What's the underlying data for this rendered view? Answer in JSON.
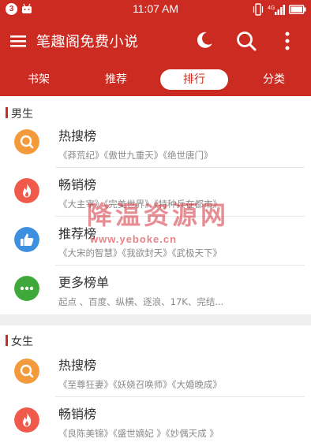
{
  "status_bar": {
    "time": "11:07 AM",
    "notification_badge": "3",
    "signal_label": "4G"
  },
  "app_bar": {
    "title": "笔趣阁免费小说",
    "icons": [
      "menu-icon",
      "moon-icon",
      "search-icon",
      "more-vert-icon"
    ]
  },
  "tabs": [
    {
      "label": "书架",
      "active": false
    },
    {
      "label": "推荐",
      "active": false
    },
    {
      "label": "排行",
      "active": true
    },
    {
      "label": "分类",
      "active": false
    }
  ],
  "sections": [
    {
      "label": "男生",
      "items": [
        {
          "title": "热搜榜",
          "subtitle": "《莽荒纪》《傲世九重天》《绝世唐门》",
          "icon": "search-icon",
          "color": "#f39a3d"
        },
        {
          "title": "畅销榜",
          "subtitle": "《大主宰》《完美世界》《特种兵在都市》",
          "icon": "fire-icon",
          "color": "#ef5a4a"
        },
        {
          "title": "推荐榜",
          "subtitle": "《大宋的智慧》《我欲封天》《武极天下》",
          "icon": "thumbs-up-icon",
          "color": "#3d8fe0"
        },
        {
          "title": "更多榜单",
          "subtitle": "起点 、百度、纵横、逐浪、17K、完结...",
          "icon": "more-dots-icon",
          "color": "#3ea83a"
        }
      ]
    },
    {
      "label": "女生",
      "items": [
        {
          "title": "热搜榜",
          "subtitle": "《至尊狂妻》《妖娆召唤师》《大婚晚成》",
          "icon": "search-icon",
          "color": "#f39a3d"
        },
        {
          "title": "畅销榜",
          "subtitle": "《良陈美锦》《盛世嫡妃 》《妙偶天成 》",
          "icon": "fire-icon",
          "color": "#ef5a4a"
        }
      ]
    }
  ],
  "watermark": {
    "title": "降温资源网",
    "url": "www.yeboke.cn"
  },
  "colors": {
    "primary": "#cc2b21",
    "divider": "#e8e8e8",
    "section_gap": "#efefef"
  }
}
